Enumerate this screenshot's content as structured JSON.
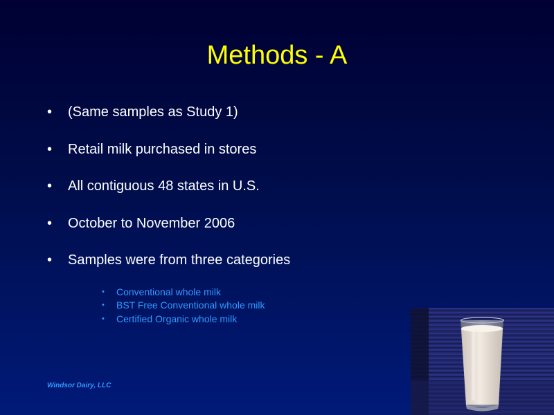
{
  "slide": {
    "title": "Methods - A",
    "bullets": [
      "(Same samples as Study 1)",
      "Retail milk purchased in stores",
      "All contiguous 48 states in U.S.",
      "October to November 2006",
      "Samples were from three categories"
    ],
    "sub_bullets": [
      "Conventional whole milk",
      "BST Free Conventional whole milk",
      "Certified Organic whole milk"
    ],
    "bullet_glyph": "•",
    "footer": "Windsor Dairy, LLC"
  },
  "colors": {
    "title": "#ffff00",
    "body_text": "#ffffff",
    "sub_text": "#3399ff",
    "background_top": "#000033",
    "background_bottom": "#001a78"
  },
  "photo": {
    "subject": "glass-of-milk",
    "icon": "milk-glass-icon"
  }
}
